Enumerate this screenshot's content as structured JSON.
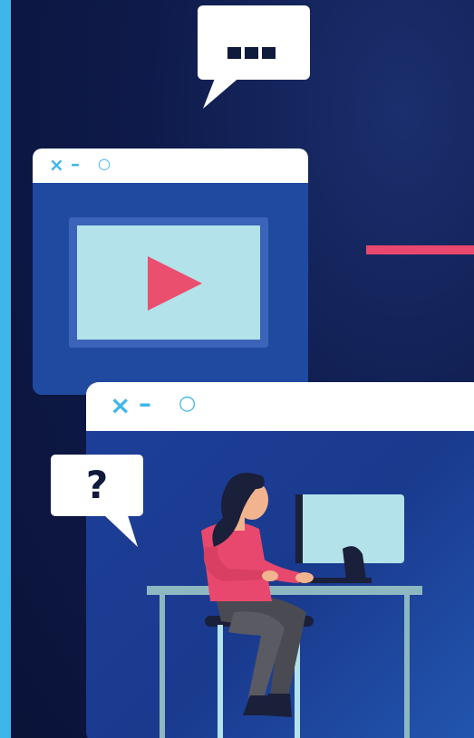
{
  "scene": {
    "title": "",
    "bubble_top": {
      "content": "typing-dots"
    },
    "window_video": {
      "controls": {
        "close": "×",
        "minimize": "–",
        "maximize": "○"
      },
      "media": "play-icon"
    },
    "window_main": {
      "controls": {
        "close": "×",
        "minimize": "–",
        "maximize": "○"
      }
    },
    "bubble_question": {
      "text": "?"
    }
  },
  "colors": {
    "background": "#0e1a4a",
    "rail": "#3fb6ea",
    "window_blue": "#1f4aa0",
    "screen": "#b3e2ea",
    "accent_red": "#e8486d",
    "white": "#ffffff"
  }
}
